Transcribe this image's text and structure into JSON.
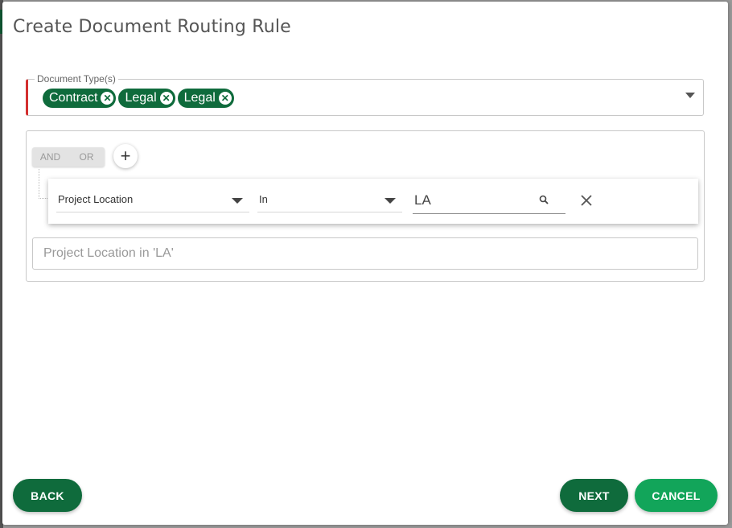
{
  "dialog": {
    "title": "Create Document Routing Rule"
  },
  "document_types": {
    "label": "Document Type(s)",
    "chips": [
      "Contract",
      "Legal",
      "Legal"
    ]
  },
  "rule_builder": {
    "combinators": {
      "and": "AND",
      "or": "OR"
    },
    "add_label": "+",
    "condition": {
      "field": "Project Location",
      "operator": "In",
      "value": "LA"
    },
    "summary_placeholder": "Project Location in 'LA'"
  },
  "buttons": {
    "back": "BACK",
    "next": "NEXT",
    "cancel": "CANCEL"
  },
  "colors": {
    "primary": "#0f6b3c",
    "accent": "#12a55a",
    "error": "#d32f2f"
  },
  "icons": {
    "chip_remove": "close-circle-icon",
    "dropdown": "caret-down-icon",
    "search": "search-icon",
    "clear": "close-icon"
  }
}
